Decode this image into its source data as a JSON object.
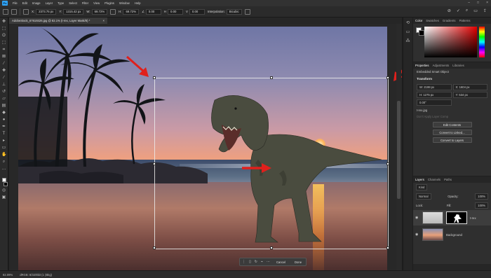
{
  "menu": {
    "items": [
      "File",
      "Edit",
      "Image",
      "Layer",
      "Type",
      "Select",
      "Filter",
      "View",
      "Plugins",
      "Window",
      "Help"
    ]
  },
  "options": {
    "x_label": "X:",
    "x_value": "2373.75 px",
    "y_label": "Y:",
    "y_value": "1315.42 px",
    "w_label": "W:",
    "w_value": "69.72%",
    "h_label": "H:",
    "h_value": "69.72%",
    "angle_value": "0.00",
    "h_skew": "0.00",
    "v_skew": "0.00",
    "interpolation_label": "Interpolation:",
    "interpolation_value": "Bicubic"
  },
  "document": {
    "tab_title": "AdobeStock_67619326.jpg @ 82.1% (t-rex, Layer Mask/8) *",
    "tab_close": "×"
  },
  "context_bar": {
    "cancel": "Cancel",
    "done": "Done"
  },
  "status": {
    "zoom": "82.09%",
    "info": "dRGB: 8/32/8bit (1 (Bkg)"
  },
  "panels": {
    "color_tabs": [
      "Color",
      "Swatches",
      "Gradients",
      "Patterns"
    ],
    "prop_tabs": [
      "Properties",
      "Adjustments",
      "Libraries"
    ],
    "smart_object": "Embedded Smart Object",
    "transform_header": "Transform",
    "w": "W: 2198 px",
    "x": "X: 1604 px",
    "h": "H: 1275 px",
    "y": "Y: 534 px",
    "angle": "0.00°",
    "layer_comp": "t-rex.jpg",
    "layer_comp_dropdown": "Don't Apply Layer Comp",
    "btn_edit": "Edit Contents",
    "btn_linked": "Convert to Linked...",
    "btn_layers": "Convert to Layers",
    "layer_tabs": [
      "Layers",
      "Channels",
      "Paths"
    ],
    "kind": "Kind",
    "blend": "Normal",
    "opacity_label": "Opacity:",
    "opacity": "100%",
    "lock_label": "Lock:",
    "fill_label": "Fill:",
    "fill": "100%",
    "layers": [
      {
        "name": "t-rex"
      },
      {
        "name": "Background"
      }
    ]
  },
  "colors": {
    "accent": "#2fa3f7",
    "arrow": "#e0201c"
  }
}
